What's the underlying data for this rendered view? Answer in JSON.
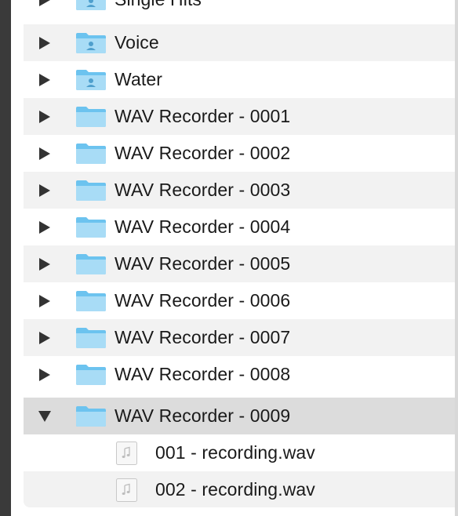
{
  "list": {
    "rows": [
      {
        "label": "Single Hits",
        "kind": "folder",
        "icon": "user-folder-icon",
        "expanded": false
      },
      {
        "label": "Voice",
        "kind": "folder",
        "icon": "user-folder-icon",
        "expanded": false
      },
      {
        "label": "Water",
        "kind": "folder",
        "icon": "user-folder-icon",
        "expanded": false
      },
      {
        "label": "WAV Recorder - 0001",
        "kind": "folder",
        "icon": "folder-icon",
        "expanded": false
      },
      {
        "label": "WAV Recorder - 0002",
        "kind": "folder",
        "icon": "folder-icon",
        "expanded": false
      },
      {
        "label": "WAV Recorder - 0003",
        "kind": "folder",
        "icon": "folder-icon",
        "expanded": false
      },
      {
        "label": "WAV Recorder - 0004",
        "kind": "folder",
        "icon": "folder-icon",
        "expanded": false
      },
      {
        "label": "WAV Recorder - 0005",
        "kind": "folder",
        "icon": "folder-icon",
        "expanded": false
      },
      {
        "label": "WAV Recorder - 0006",
        "kind": "folder",
        "icon": "folder-icon",
        "expanded": false
      },
      {
        "label": "WAV Recorder - 0007",
        "kind": "folder",
        "icon": "folder-icon",
        "expanded": false
      },
      {
        "label": "WAV Recorder - 0008",
        "kind": "folder",
        "icon": "folder-icon",
        "expanded": false
      },
      {
        "label": "WAV Recorder - 0009",
        "kind": "folder",
        "icon": "folder-icon",
        "expanded": true,
        "selected": true
      },
      {
        "label": "001 - recording.wav",
        "kind": "file",
        "icon": "audio-file-icon"
      },
      {
        "label": "002 - recording.wav",
        "kind": "file",
        "icon": "audio-file-icon"
      }
    ]
  },
  "colors": {
    "folder_light": "#a8dcf6",
    "folder_dark": "#6cc3ef",
    "row_alt": "#f2f2f2",
    "row_selected": "#dcdcdc"
  }
}
